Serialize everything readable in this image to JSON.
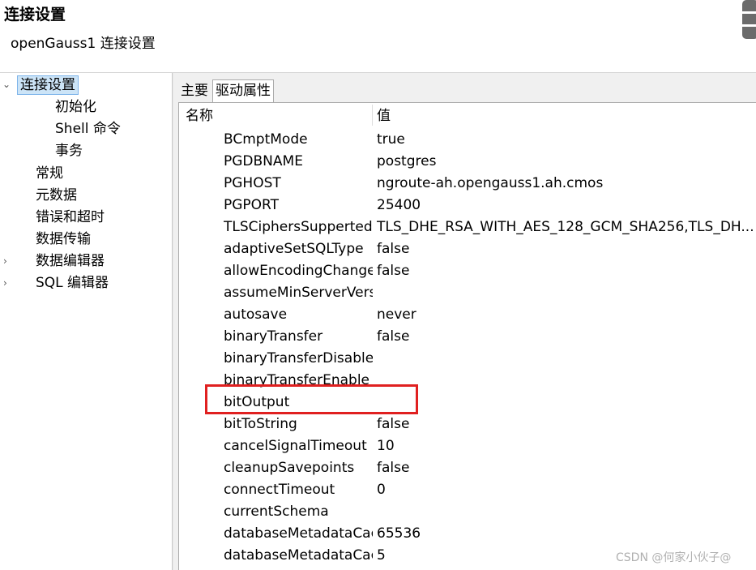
{
  "header": {
    "title": "连接设置",
    "subtitle": "openGauss1 连接设置"
  },
  "tree": {
    "items": [
      {
        "label": "连接设置",
        "arrow": "⌄"
      },
      {
        "label": "初始化"
      },
      {
        "label": "Shell 命令"
      },
      {
        "label": "事务"
      },
      {
        "label": "常规"
      },
      {
        "label": "元数据"
      },
      {
        "label": "错误和超时"
      },
      {
        "label": "数据传输"
      },
      {
        "label": "数据编辑器",
        "arrow": "›"
      },
      {
        "label": "SQL 编辑器",
        "arrow": "›"
      }
    ]
  },
  "tabs": [
    {
      "label": "主要"
    },
    {
      "label": "驱动属性"
    }
  ],
  "table": {
    "columns": [
      "名称",
      "值"
    ],
    "rows": [
      {
        "name": "BCmptMode",
        "value": "true"
      },
      {
        "name": "PGDBNAME",
        "value": "postgres"
      },
      {
        "name": "PGHOST",
        "value": "ngroute-ah.opengauss1.ah.cmos"
      },
      {
        "name": "PGPORT",
        "value": "25400"
      },
      {
        "name": "TLSCiphersSupperted",
        "value": "TLS_DHE_RSA_WITH_AES_128_GCM_SHA256,TLS_DH..."
      },
      {
        "name": "adaptiveSetSQLType",
        "value": "false"
      },
      {
        "name": "allowEncodingChanges",
        "value": "false"
      },
      {
        "name": "assumeMinServerVersion",
        "value": ""
      },
      {
        "name": "autosave",
        "value": "never"
      },
      {
        "name": "binaryTransfer",
        "value": "false"
      },
      {
        "name": "binaryTransferDisable",
        "value": ""
      },
      {
        "name": "binaryTransferEnable",
        "value": ""
      },
      {
        "name": "bitOutput",
        "value": ""
      },
      {
        "name": "bitToString",
        "value": "false"
      },
      {
        "name": "cancelSignalTimeout",
        "value": "10"
      },
      {
        "name": "cleanupSavepoints",
        "value": "false"
      },
      {
        "name": "connectTimeout",
        "value": "0"
      },
      {
        "name": "currentSchema",
        "value": ""
      },
      {
        "name": "databaseMetadataCacheFields",
        "value": "65536"
      },
      {
        "name": "databaseMetadataCacheFieldsMiB",
        "value": "5"
      }
    ]
  },
  "watermark": "CSDN @何家小伙子@",
  "colors": {
    "highlight": "#e02020",
    "selection": "#cce4f7"
  },
  "icons": {
    "header_right": "database-icon"
  }
}
